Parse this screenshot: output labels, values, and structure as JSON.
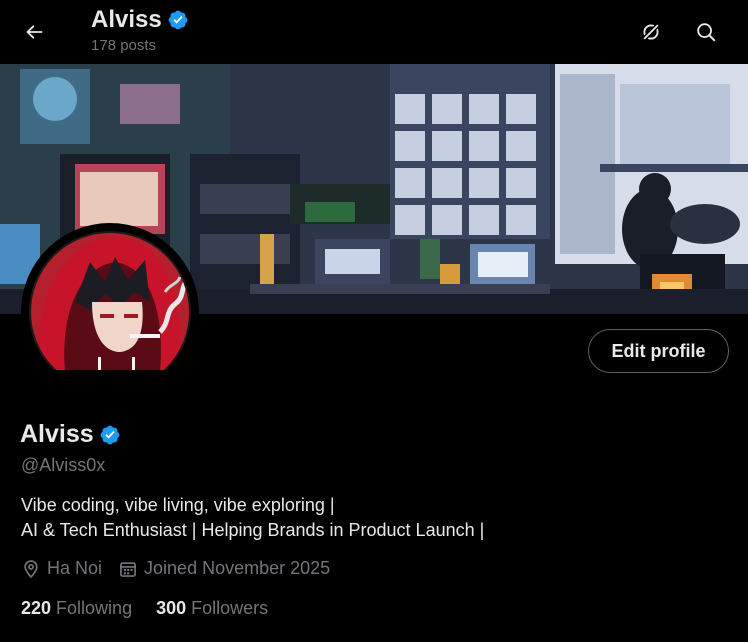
{
  "header": {
    "name": "Alviss",
    "posts_count": "178 posts"
  },
  "profile": {
    "display_name": "Alviss",
    "handle": "@Alviss0x",
    "bio_line1": "Vibe coding, vibe living, vibe exploring |",
    "bio_line2": "AI & Tech Enthusiast | Helping Brands in Product Launch |",
    "location": "Ha Noi",
    "joined": "Joined November 2025",
    "following_count": "220",
    "following_label": "Following",
    "followers_count": "300",
    "followers_label": "Followers",
    "edit_button": "Edit profile"
  },
  "colors": {
    "background": "#000000",
    "verified": "#1d9bf0",
    "text_primary": "#e7e9ea",
    "text_secondary": "#71767b",
    "button_border": "#536471"
  },
  "icons": {
    "back": "arrow-left-icon",
    "grok": "grok-icon",
    "search": "search-icon",
    "verified": "verified-badge-icon",
    "location": "location-pin-icon",
    "calendar": "calendar-icon"
  }
}
